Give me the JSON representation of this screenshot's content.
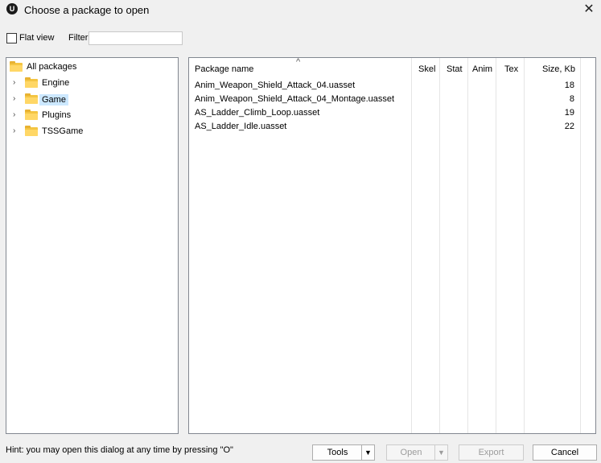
{
  "window": {
    "title": "Choose a package to open",
    "app_icon": "U",
    "close_glyph": "✕"
  },
  "toolbar": {
    "flat_view_label": "Flat view",
    "flat_view_checked": false,
    "filter_label": "Filter:",
    "filter_value": ""
  },
  "tree": {
    "root_label": "All packages",
    "items": [
      {
        "label": "Engine",
        "selected": false
      },
      {
        "label": "Game",
        "selected": true
      },
      {
        "label": "Plugins",
        "selected": false
      },
      {
        "label": "TSSGame",
        "selected": false
      }
    ]
  },
  "list": {
    "columns": [
      "Package name",
      "Skel",
      "Stat",
      "Anim",
      "Tex",
      "Size, Kb"
    ],
    "rows": [
      {
        "name": "Anim_Weapon_Shield_Attack_04.uasset",
        "size": "18"
      },
      {
        "name": "Anim_Weapon_Shield_Attack_04_Montage.uasset",
        "size": "8"
      },
      {
        "name": "AS_Ladder_Climb_Loop.uasset",
        "size": "19"
      },
      {
        "name": "AS_Ladder_Idle.uasset",
        "size": "22"
      }
    ]
  },
  "footer": {
    "hint": "Hint: you may open this dialog at any time by pressing \"O\"",
    "tools_label": "Tools",
    "open_label": "Open",
    "export_label": "Export",
    "cancel_label": "Cancel"
  }
}
